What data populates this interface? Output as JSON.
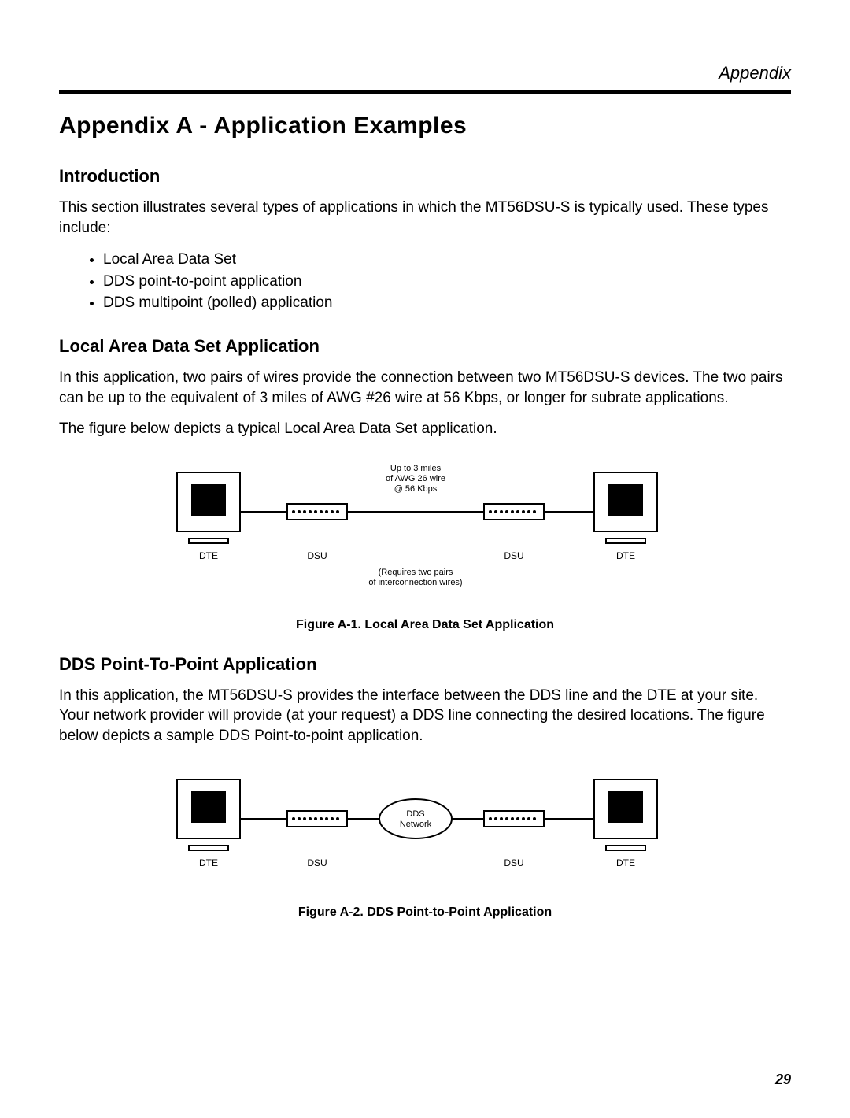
{
  "header": {
    "section": "Appendix"
  },
  "title": "Appendix A - Application Examples",
  "intro": {
    "heading": "Introduction",
    "para": "This section illustrates several types of applications in which the MT56DSU-S is typically used. These types include:",
    "bullets": [
      "Local Area Data Set",
      "DDS point-to-point application",
      "DDS multipoint (polled) application"
    ]
  },
  "lads": {
    "heading": "Local Area Data Set Application",
    "para1": "In this application, two pairs of wires provide the connection between two MT56DSU-S devices. The two pairs can be up to the equivalent of 3 miles of AWG #26 wire at 56 Kbps, or longer for subrate applications.",
    "para2": "The figure below depicts a typical Local Area Data Set application.",
    "fig_caption": "Figure A-1.   Local Area Data Set Application",
    "fig": {
      "upline1": "Up to 3 miles",
      "upline2": "of AWG 26 wire",
      "upline3": "@ 56 Kbps",
      "reqline1": "(Requires two pairs",
      "reqline2": "of interconnection wires)",
      "dte": "DTE",
      "dsu": "DSU"
    }
  },
  "ptp": {
    "heading": "DDS Point-To-Point Application",
    "para1": "In this application, the MT56DSU-S provides the interface between the DDS line and the DTE at your site. Your network provider will provide (at your request) a DDS line connecting the desired locations. The figure below depicts a sample DDS Point-to-point application.",
    "fig_caption": "Figure A-2.  DDS Point-to-Point Application",
    "fig": {
      "dds1": "DDS",
      "dds2": "Network",
      "dte": "DTE",
      "dsu": "DSU"
    }
  },
  "page_number": "29"
}
